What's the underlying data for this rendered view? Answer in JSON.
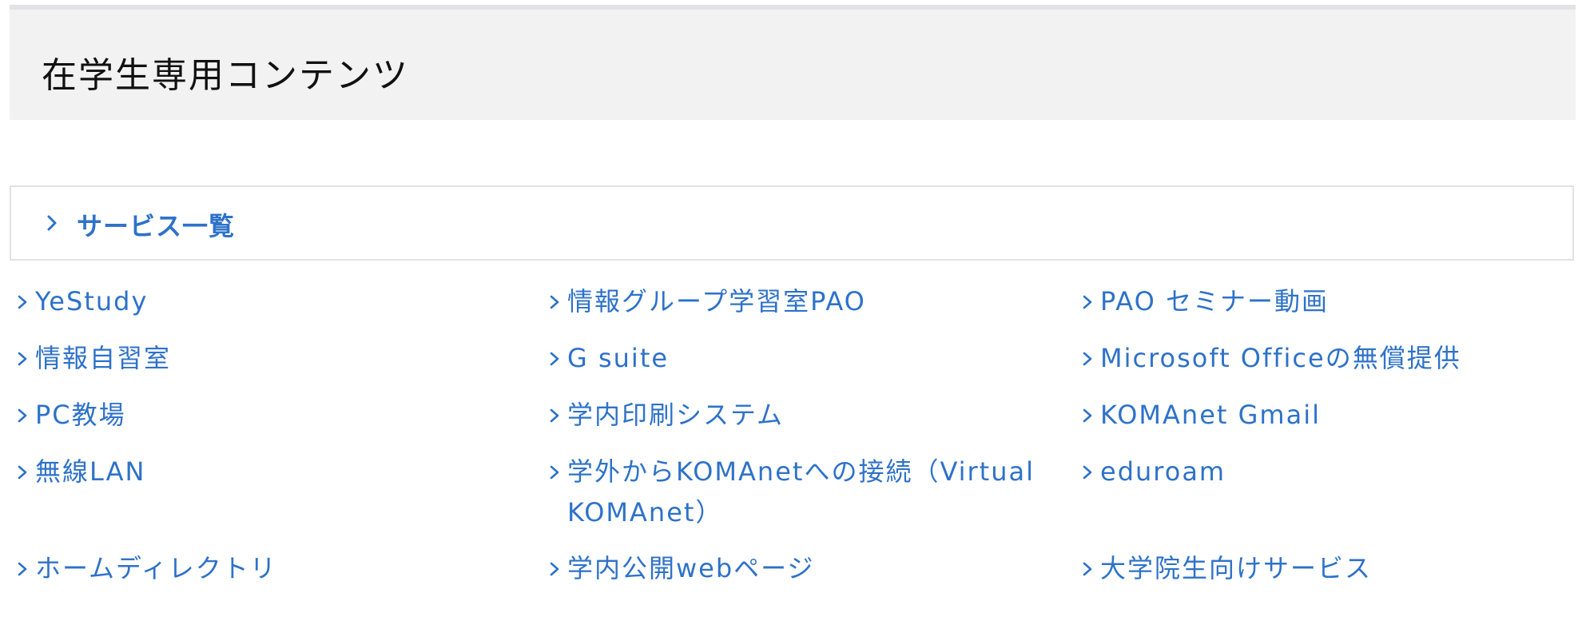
{
  "header": {
    "title": "在学生専用コンテンツ"
  },
  "section": {
    "title": "サービス一覧"
  },
  "links": [
    {
      "label": "YeStudy"
    },
    {
      "label": "情報グループ学習室PAO"
    },
    {
      "label": "PAO セミナー動画"
    },
    {
      "label": "情報自習室"
    },
    {
      "label": "G suite"
    },
    {
      "label": "Microsoft Officeの無償提供"
    },
    {
      "label": "PC教場"
    },
    {
      "label": "学内印刷システム"
    },
    {
      "label": "KOMAnet Gmail"
    },
    {
      "label": "無線LAN"
    },
    {
      "label": "学外からKOMAnetへの接続（Virtual KOMAnet）"
    },
    {
      "label": "eduroam"
    },
    {
      "label": "ホームディレクトリ"
    },
    {
      "label": "学内公開webページ"
    },
    {
      "label": "大学院生向けサービス"
    }
  ],
  "icons": {
    "link_chevron": "chevron-right-icon",
    "section_chevron": "chevron-right-icon"
  },
  "colors": {
    "accent": "#2e72c9",
    "header_bg": "#f2f2f3",
    "border": "#e2e2e4"
  }
}
